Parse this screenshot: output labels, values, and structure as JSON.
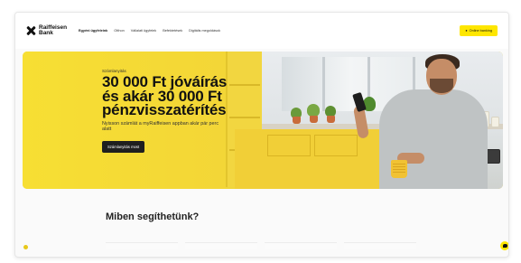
{
  "nav": {
    "logo_text": "Raiffeisen Bank",
    "items": [
      {
        "label": "Egyéni ügyfeleink",
        "active": true
      },
      {
        "label": "Otthon"
      },
      {
        "label": "Vállalati ügyfelek"
      },
      {
        "label": "Befektetések"
      },
      {
        "label": "Digitális megoldások"
      }
    ],
    "login_label": "Online banking"
  },
  "hero": {
    "eyebrow": "Számlanyitás",
    "headline_line1": "30 000 Ft jóváírás",
    "headline_line2": "és akár 30 000 Ft",
    "headline_line3": "pénzvisszatérítés",
    "subtext": "Nyisson számlát a myRaiffeisen appban akár pár perc alatt",
    "cta_label": "Számlanyitás most"
  },
  "help": {
    "title": "Miben segíthetünk?"
  },
  "colors": {
    "brand_yellow": "#fee600",
    "hero_yellow": "#f3d637",
    "cta_dark": "#1f1f1f"
  },
  "icons": {
    "logo": "raiffeisen-cross-icon",
    "login": "user-icon",
    "chat": "chat-icon"
  }
}
